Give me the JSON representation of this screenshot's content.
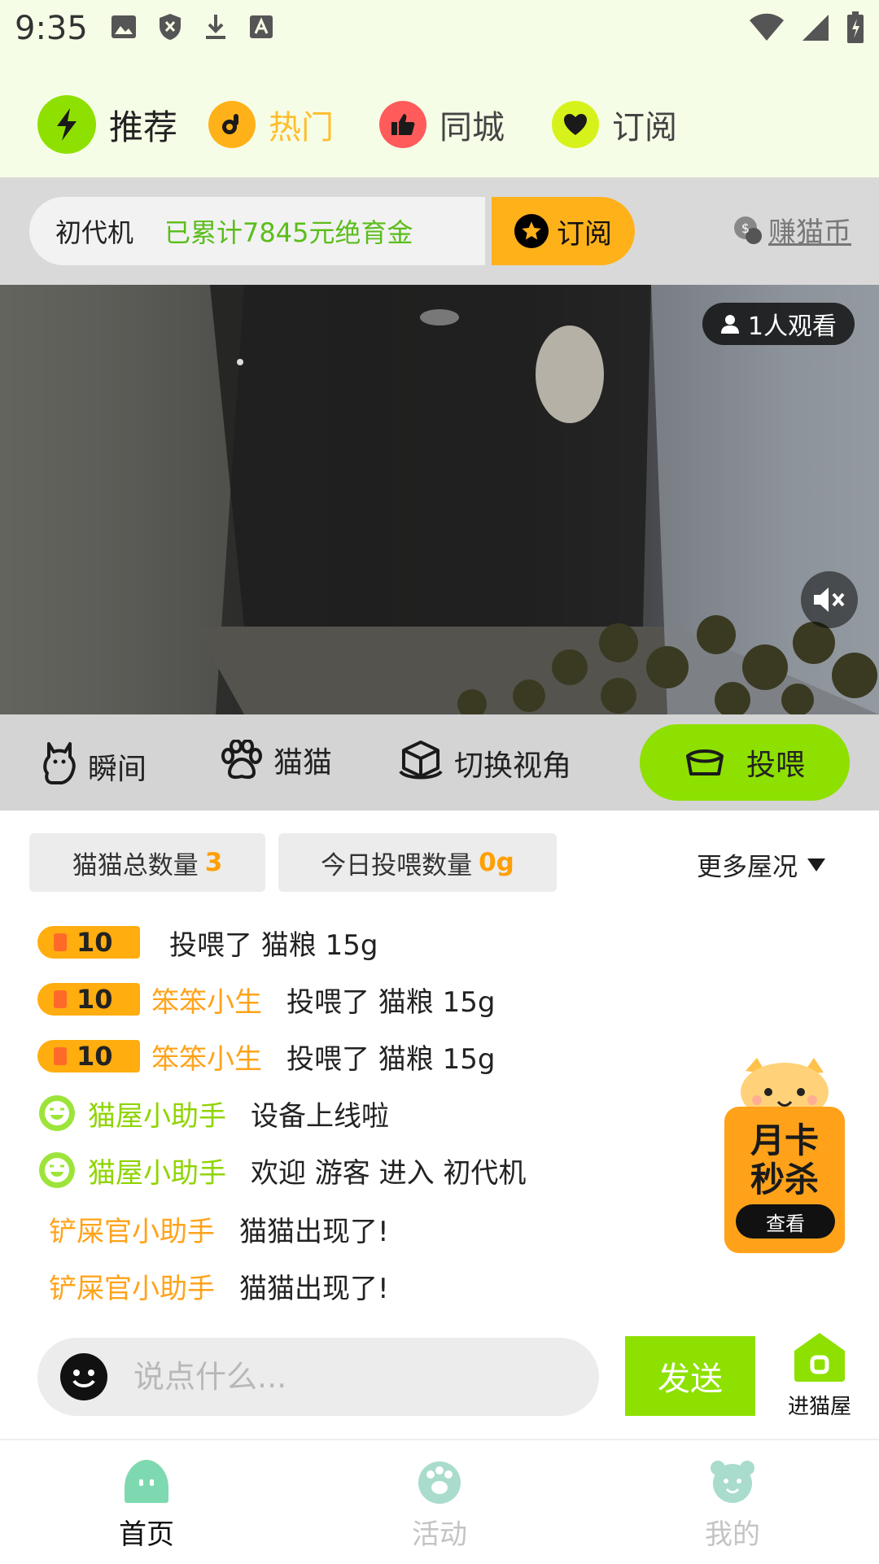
{
  "status_bar": {
    "time": "9:35"
  },
  "top_tabs": [
    {
      "label": "推荐",
      "active": true,
      "color": "#8ee000"
    },
    {
      "label": "热门",
      "active": false,
      "color": "#ffb11a"
    },
    {
      "label": "同城",
      "active": false,
      "color": "#ff5b5b"
    },
    {
      "label": "订阅",
      "active": false,
      "color": "#d6f21a"
    }
  ],
  "banner": {
    "device_name": "初代机",
    "fund_text": "已累计7845元绝育金",
    "subscribe_label": "订阅",
    "earn_label": "赚猫币"
  },
  "video": {
    "viewers_label": "1人观看"
  },
  "controls": [
    {
      "label": "瞬间",
      "icon": "cat-sit-icon"
    },
    {
      "label": "猫猫",
      "icon": "paw-icon"
    },
    {
      "label": "切换视角",
      "icon": "camera-cube-icon"
    }
  ],
  "feed_button": {
    "label": "投喂"
  },
  "stats": {
    "total_cats_label": "猫猫总数量",
    "total_cats_value": "3",
    "today_feed_label": "今日投喂数量",
    "today_feed_value": "0g",
    "more_label": "更多屋况"
  },
  "feed_log": [
    {
      "type": "badge",
      "badge": "10",
      "name": "",
      "message": "投喂了 猫粮 15g"
    },
    {
      "type": "badge",
      "badge": "10",
      "name": "笨笨小生",
      "message": "投喂了 猫粮 15g"
    },
    {
      "type": "badge",
      "badge": "10",
      "name": "笨笨小生",
      "message": "投喂了 猫粮 15g"
    },
    {
      "type": "bot",
      "name": "猫屋小助手",
      "message": "设备上线啦"
    },
    {
      "type": "bot",
      "name": "猫屋小助手",
      "message": "欢迎 游客 进入 初代机"
    },
    {
      "type": "plain",
      "name": "铲屎官小助手",
      "message": "猫猫出现了!"
    },
    {
      "type": "plain",
      "name": "铲屎官小助手",
      "message": "猫猫出现了!"
    }
  ],
  "promo": {
    "line1": "月卡",
    "line2": "秒杀",
    "button": "查看"
  },
  "chat": {
    "placeholder": "说点什么...",
    "send_label": "发送",
    "enter_label": "进猫屋"
  },
  "bottom_nav": [
    {
      "label": "首页",
      "active": true
    },
    {
      "label": "活动",
      "active": false
    },
    {
      "label": "我的",
      "active": false
    }
  ]
}
